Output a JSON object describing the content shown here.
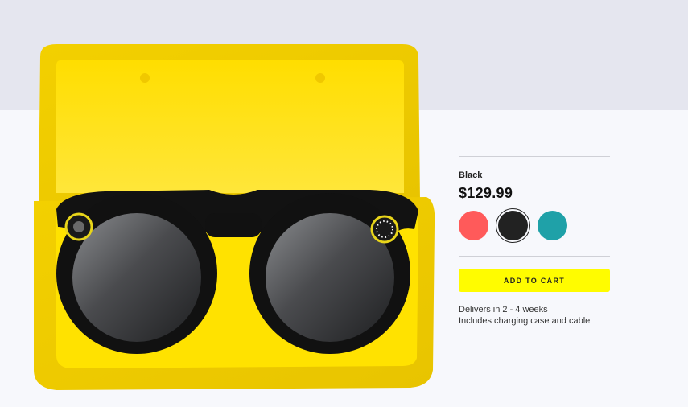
{
  "product": {
    "color_name": "Black",
    "price": "$129.99",
    "swatches": [
      {
        "name": "Coral",
        "hex": "#ff5a5a",
        "selected": false
      },
      {
        "name": "Black",
        "hex": "#222222",
        "selected": true
      },
      {
        "name": "Teal",
        "hex": "#1fa1a8",
        "selected": false
      }
    ],
    "add_to_cart_label": "ADD TO CART",
    "delivery_line": "Delivers in 2 - 4 weeks",
    "includes_line": "Includes charging case and cable"
  },
  "colors": {
    "accent": "#fffc00",
    "case_yellow": "#ffe000",
    "top_band": "#e5e6ef",
    "background": "#f7f8fc"
  },
  "image": {
    "subject": "sunglasses-in-case"
  }
}
